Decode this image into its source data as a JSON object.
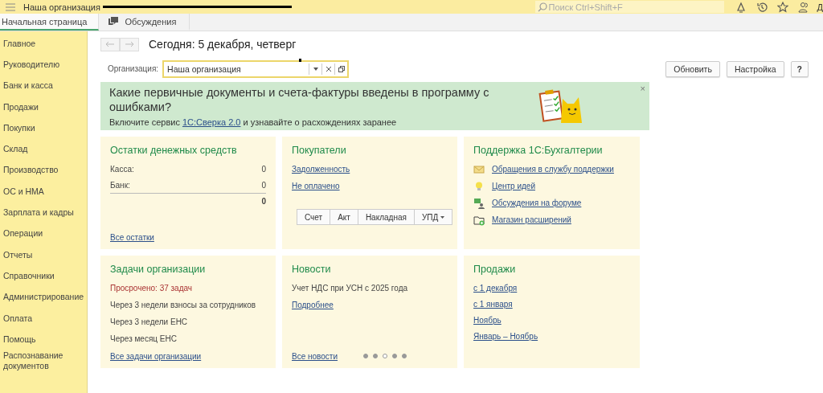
{
  "window": {
    "title": "Наша организация",
    "search_placeholder": "Поиск Ctrl+Shift+F",
    "user_initial": "Д"
  },
  "tabs": [
    {
      "label": "Начальная страница",
      "selected": true,
      "kind": "home"
    },
    {
      "label": "Обсуждения",
      "selected": false,
      "kind": "chat"
    }
  ],
  "sidebar": {
    "items": [
      {
        "label": "Главное"
      },
      {
        "label": "Руководителю"
      },
      {
        "label": "Банк и касса"
      },
      {
        "label": "Продажи"
      },
      {
        "label": "Покупки"
      },
      {
        "label": "Склад"
      },
      {
        "label": "Производство"
      },
      {
        "label": "ОС и НМА"
      },
      {
        "label": "Зарплата и кадры"
      },
      {
        "label": "Операции"
      },
      {
        "label": "Отчеты"
      },
      {
        "label": "Справочники"
      },
      {
        "label": "Администрирование"
      },
      {
        "label": "Оплата"
      },
      {
        "label": "Помощь"
      },
      {
        "label": "Распознавание документов"
      }
    ]
  },
  "header": {
    "title": "Сегодня: 5 декабря, четверг"
  },
  "organization": {
    "label": "Организация:",
    "value": "Наша организация"
  },
  "buttons": [
    "Обновить",
    "Настройка",
    "?"
  ],
  "banner": {
    "title": "Какие первичные документы и счета-фактуры введены в программу с ошибками?",
    "text_before": "Включите сервис ",
    "link": "1С:Сверка 2.0",
    "text_after": " и узнавайте о расхождениях заранее",
    "close": "×"
  },
  "cards": [
    {
      "kind": "balances",
      "title": "Остатки денежных средств",
      "rows": [
        {
          "label": "Касса:",
          "value": "0"
        },
        {
          "label": "Банк:",
          "value": "0"
        }
      ],
      "total": "0",
      "footer_link": "Все остатки"
    },
    {
      "kind": "customers",
      "title": "Покупатели",
      "links": [
        "Задолженность",
        "Не оплачено"
      ],
      "doc_buttons": [
        "Счет",
        "Акт",
        "Накладная",
        "УПД"
      ]
    },
    {
      "kind": "support",
      "title": "Поддержка 1С:Бухгалтерии",
      "items": [
        {
          "label": "Обращения в службу поддержки",
          "kind": "mail"
        },
        {
          "label": "Центр идей",
          "kind": "bulb"
        },
        {
          "label": "Обсуждения на форуме",
          "kind": "forum"
        },
        {
          "label": "Магазин расширений",
          "kind": "store"
        }
      ]
    },
    {
      "kind": "tasks",
      "title": "Задачи организации",
      "overdue": "Просрочено: 37 задач",
      "lines": [
        "Через 3 недели взносы за сотрудников",
        "Через 3 недели ЕНС",
        "Через месяц ЕНС"
      ],
      "footer_link": "Все задачи организации"
    },
    {
      "kind": "news",
      "title": "Новости",
      "headline": "Учет НДС при УСН с 2025 года",
      "more_link": "Подробнее",
      "footer_link": "Все новости",
      "dots": [
        {
          "selected": false
        },
        {
          "selected": false
        },
        {
          "selected": true
        },
        {
          "selected": false
        },
        {
          "selected": false
        }
      ]
    },
    {
      "kind": "sales",
      "title": "Продажи",
      "links": [
        "с 1 декабря",
        "с 1 января",
        "Ноябрь",
        "Январь – Ноябрь"
      ]
    }
  ]
}
